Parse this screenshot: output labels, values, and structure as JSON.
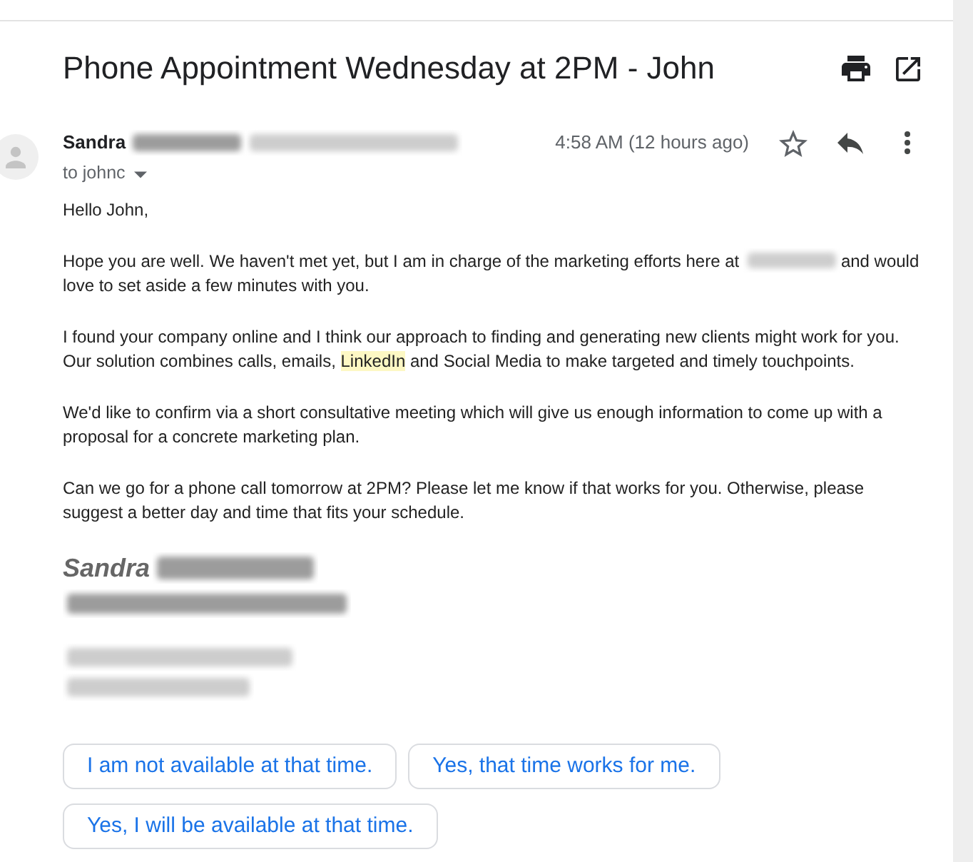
{
  "message": {
    "subject": "Phone Appointment Wednesday at 2PM - John",
    "sender": {
      "name": "Sandra",
      "details_redacted": true
    },
    "recipient": "to johnc",
    "time": "4:58 AM (12 hours ago)",
    "starred": false
  },
  "body": {
    "paragraphs": [
      {
        "parts": [
          {
            "kind": "text",
            "text": "Hello John,"
          }
        ]
      },
      {
        "parts": [
          {
            "kind": "text",
            "text": "Hope you are well. We haven't met yet, but I am in charge of the marketing efforts here at "
          },
          {
            "kind": "redacted"
          },
          {
            "kind": "text",
            "text": "and would love to set aside a few minutes with you."
          }
        ]
      },
      {
        "parts": [
          {
            "kind": "text",
            "text": "I found your company online and I think our approach to finding and generating new clients might work for you. Our solution combines calls, emails, "
          },
          {
            "kind": "highlight",
            "text": "LinkedIn"
          },
          {
            "kind": "text",
            "text": " and Social Media to make targeted and timely touchpoints."
          }
        ]
      },
      {
        "parts": [
          {
            "kind": "text",
            "text": "We'd like to confirm via a short consultative meeting which will give us enough information to come up with a proposal for a concrete marketing plan."
          }
        ]
      },
      {
        "parts": [
          {
            "kind": "text",
            "text": "Can we go for a phone call tomorrow at 2PM? Please let me know if that works for you. Otherwise, please suggest a better day and time that fits your schedule."
          }
        ]
      }
    ],
    "signature": {
      "name": "Sandra",
      "details_redacted": true
    }
  },
  "smart_replies": [
    {
      "label": "I am not available at that time."
    },
    {
      "label": "Yes, that time works for me."
    },
    {
      "label": "Yes, I will be available at that time."
    }
  ]
}
